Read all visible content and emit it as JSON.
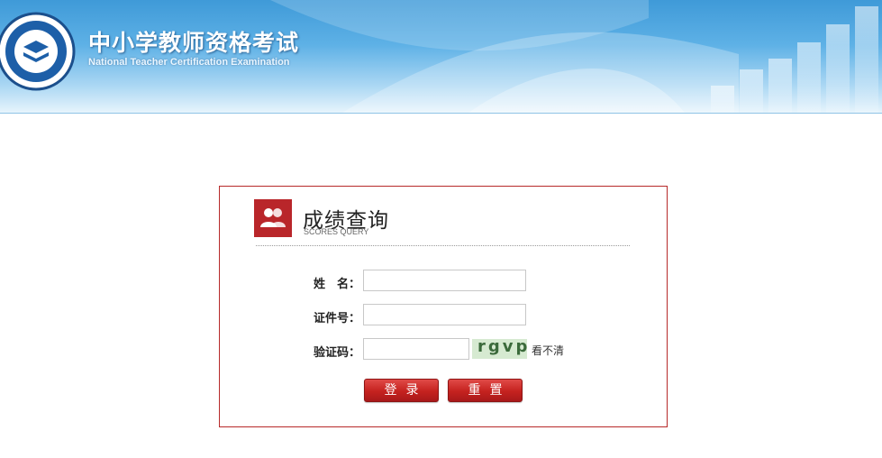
{
  "header": {
    "title": "中小学教师资格考试",
    "subtitle": "National Teacher Certification Examination"
  },
  "panel": {
    "title": "成绩查询",
    "subtitle": "SCORES QUERY"
  },
  "form": {
    "name_label": "姓　名：",
    "name_value": "",
    "id_label": "证件号：",
    "id_value": "",
    "captcha_label": "验证码：",
    "captcha_value": "",
    "captcha_text": "rgvp",
    "captcha_refresh": "看不清"
  },
  "buttons": {
    "login": "登录",
    "reset": "重置"
  },
  "colors": {
    "accent": "#b9262a",
    "banner": "#3f9ad8"
  }
}
